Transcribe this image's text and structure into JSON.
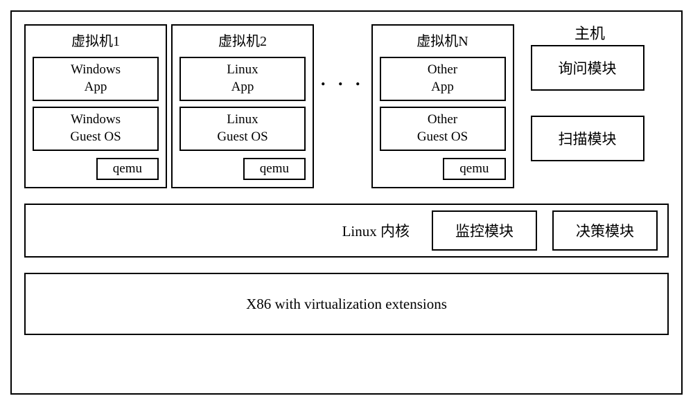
{
  "host_title": "主机",
  "vms": [
    {
      "title": "虚拟机1",
      "app": "Windows\nApp",
      "guest": "Windows\nGuest OS",
      "qemu": "qemu"
    },
    {
      "title": "虚拟机2",
      "app": "Linux\nApp",
      "guest": "Linux\nGuest OS",
      "qemu": "qemu"
    },
    {
      "title": "虚拟机N",
      "app": "Other\nApp",
      "guest": "Other\nGuest OS",
      "qemu": "qemu"
    }
  ],
  "ellipsis": ". . .",
  "right_modules": {
    "query": "询问模块",
    "scan": "扫描模块"
  },
  "kernel": {
    "label": "Linux 内核",
    "monitor": "监控模块",
    "decision": "决策模块"
  },
  "hardware": "X86 with virtualization extensions",
  "chart_data": {
    "type": "diagram",
    "title": "主机",
    "description": "KVM/QEMU-style virtualization architecture on a single host",
    "layers": [
      {
        "name": "主机 (Host)",
        "children": [
          {
            "name": "虚拟机1",
            "components": [
              "Windows App",
              "Windows Guest OS",
              "qemu"
            ]
          },
          {
            "name": "虚拟机2",
            "components": [
              "Linux App",
              "Linux Guest OS",
              "qemu"
            ]
          },
          {
            "name": "...",
            "components": []
          },
          {
            "name": "虚拟机N",
            "components": [
              "Other App",
              "Other Guest OS",
              "qemu"
            ]
          },
          {
            "name": "询问模块",
            "components": []
          },
          {
            "name": "扫描模块",
            "components": []
          }
        ]
      },
      {
        "name": "Linux 内核",
        "children": [
          {
            "name": "监控模块",
            "components": []
          },
          {
            "name": "决策模块",
            "components": []
          }
        ]
      },
      {
        "name": "X86 with virtualization extensions",
        "children": []
      }
    ]
  }
}
